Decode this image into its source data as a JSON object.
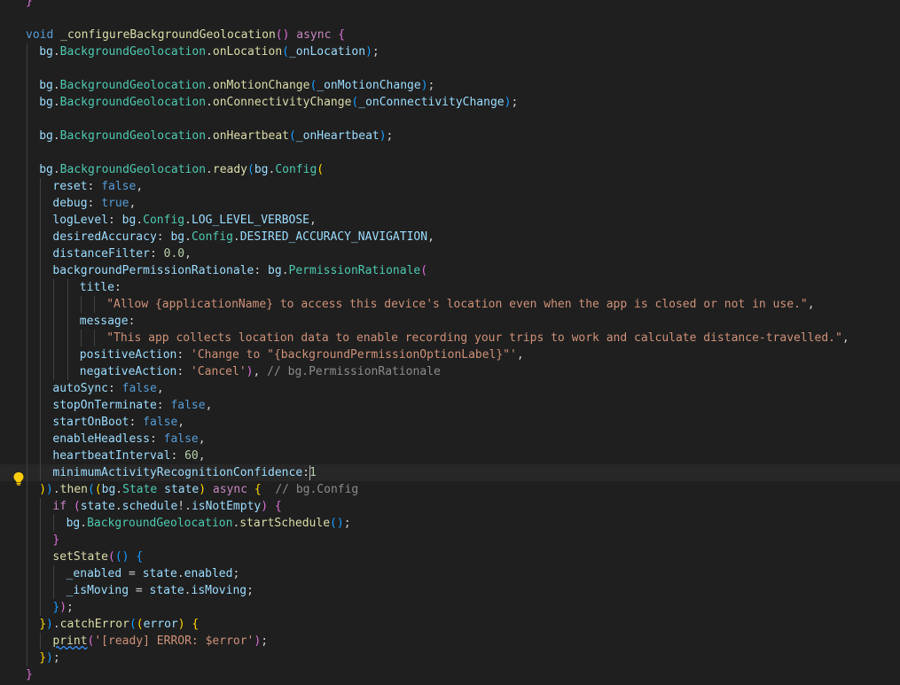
{
  "editor": {
    "lines": [
      {
        "i": 0,
        "t": [
          [
            "}",
            "br2"
          ]
        ]
      },
      {
        "i": 0,
        "t": []
      },
      {
        "i": 0,
        "t": [
          [
            "void",
            "bool"
          ],
          [
            " ",
            "plain"
          ],
          [
            "_configureBackgroundGeolocation",
            "fn"
          ],
          [
            "()",
            "br2"
          ],
          [
            " ",
            "plain"
          ],
          [
            "async",
            "kw"
          ],
          [
            " ",
            "plain"
          ],
          [
            "{",
            "br2"
          ]
        ]
      },
      {
        "i": 1,
        "t": [
          [
            "bg",
            "var"
          ],
          [
            ".",
            "plain"
          ],
          [
            "BackgroundGeolocation",
            "type"
          ],
          [
            ".",
            "plain"
          ],
          [
            "onLocation",
            "fn"
          ],
          [
            "(",
            "br3"
          ],
          [
            "_onLocation",
            "var"
          ],
          [
            ")",
            "br3"
          ],
          [
            ";",
            "plain"
          ]
        ]
      },
      {
        "i": 1,
        "t": []
      },
      {
        "i": 1,
        "t": [
          [
            "bg",
            "var"
          ],
          [
            ".",
            "plain"
          ],
          [
            "BackgroundGeolocation",
            "type"
          ],
          [
            ".",
            "plain"
          ],
          [
            "onMotionChange",
            "fn"
          ],
          [
            "(",
            "br3"
          ],
          [
            "_onMotionChange",
            "var"
          ],
          [
            ")",
            "br3"
          ],
          [
            ";",
            "plain"
          ]
        ]
      },
      {
        "i": 1,
        "t": [
          [
            "bg",
            "var"
          ],
          [
            ".",
            "plain"
          ],
          [
            "BackgroundGeolocation",
            "type"
          ],
          [
            ".",
            "plain"
          ],
          [
            "onConnectivityChange",
            "fn"
          ],
          [
            "(",
            "br3"
          ],
          [
            "_onConnectivityChange",
            "var"
          ],
          [
            ")",
            "br3"
          ],
          [
            ";",
            "plain"
          ]
        ]
      },
      {
        "i": 1,
        "t": []
      },
      {
        "i": 1,
        "t": [
          [
            "bg",
            "var"
          ],
          [
            ".",
            "plain"
          ],
          [
            "BackgroundGeolocation",
            "type"
          ],
          [
            ".",
            "plain"
          ],
          [
            "onHeartbeat",
            "fn"
          ],
          [
            "(",
            "br3"
          ],
          [
            "_onHeartbeat",
            "var"
          ],
          [
            ")",
            "br3"
          ],
          [
            ";",
            "plain"
          ]
        ]
      },
      {
        "i": 1,
        "t": []
      },
      {
        "i": 1,
        "t": [
          [
            "bg",
            "var"
          ],
          [
            ".",
            "plain"
          ],
          [
            "BackgroundGeolocation",
            "type"
          ],
          [
            ".",
            "plain"
          ],
          [
            "ready",
            "fn"
          ],
          [
            "(",
            "br3"
          ],
          [
            "bg",
            "var"
          ],
          [
            ".",
            "plain"
          ],
          [
            "Config",
            "type"
          ],
          [
            "(",
            "br1"
          ]
        ]
      },
      {
        "i": 2,
        "t": [
          [
            "reset",
            "var"
          ],
          [
            ": ",
            "plain"
          ],
          [
            "false",
            "bool"
          ],
          [
            ",",
            "plain"
          ]
        ]
      },
      {
        "i": 2,
        "t": [
          [
            "debug",
            "var"
          ],
          [
            ": ",
            "plain"
          ],
          [
            "true",
            "bool"
          ],
          [
            ",",
            "plain"
          ]
        ]
      },
      {
        "i": 2,
        "t": [
          [
            "logLevel",
            "var"
          ],
          [
            ": ",
            "plain"
          ],
          [
            "bg",
            "var"
          ],
          [
            ".",
            "plain"
          ],
          [
            "Config",
            "type"
          ],
          [
            ".",
            "plain"
          ],
          [
            "LOG_LEVEL_VERBOSE",
            "var"
          ],
          [
            ",",
            "plain"
          ]
        ]
      },
      {
        "i": 2,
        "t": [
          [
            "desiredAccuracy",
            "var"
          ],
          [
            ": ",
            "plain"
          ],
          [
            "bg",
            "var"
          ],
          [
            ".",
            "plain"
          ],
          [
            "Config",
            "type"
          ],
          [
            ".",
            "plain"
          ],
          [
            "DESIRED_ACCURACY_NAVIGATION",
            "var"
          ],
          [
            ",",
            "plain"
          ]
        ]
      },
      {
        "i": 2,
        "t": [
          [
            "distanceFilter",
            "var"
          ],
          [
            ": ",
            "plain"
          ],
          [
            "0.0",
            "num"
          ],
          [
            ",",
            "plain"
          ]
        ]
      },
      {
        "i": 2,
        "t": [
          [
            "backgroundPermissionRationale",
            "var"
          ],
          [
            ": ",
            "plain"
          ],
          [
            "bg",
            "var"
          ],
          [
            ".",
            "plain"
          ],
          [
            "PermissionRationale",
            "type"
          ],
          [
            "(",
            "br2"
          ]
        ]
      },
      {
        "i": 4,
        "t": [
          [
            "title",
            "var"
          ],
          [
            ":",
            "plain"
          ]
        ]
      },
      {
        "i": 6,
        "t": [
          [
            "\"Allow {applicationName} to access this device's location even when the app is closed or not in use.\"",
            "str"
          ],
          [
            ",",
            "plain"
          ]
        ]
      },
      {
        "i": 4,
        "t": [
          [
            "message",
            "var"
          ],
          [
            ":",
            "plain"
          ]
        ]
      },
      {
        "i": 6,
        "t": [
          [
            "\"This app collects location data to enable recording your trips to work and calculate distance-travelled.\"",
            "str"
          ],
          [
            ",",
            "plain"
          ]
        ]
      },
      {
        "i": 4,
        "t": [
          [
            "positiveAction",
            "var"
          ],
          [
            ": ",
            "plain"
          ],
          [
            "'Change to \"{backgroundPermissionOptionLabel}\"'",
            "str"
          ],
          [
            ",",
            "plain"
          ]
        ]
      },
      {
        "i": 4,
        "t": [
          [
            "negativeAction",
            "var"
          ],
          [
            ": ",
            "plain"
          ],
          [
            "'Cancel'",
            "str"
          ],
          [
            ")",
            "br2"
          ],
          [
            ", ",
            "plain"
          ],
          [
            "// bg.PermissionRationale",
            "hint"
          ]
        ]
      },
      {
        "i": 2,
        "t": [
          [
            "autoSync",
            "var"
          ],
          [
            ": ",
            "plain"
          ],
          [
            "false",
            "bool"
          ],
          [
            ",",
            "plain"
          ]
        ]
      },
      {
        "i": 2,
        "t": [
          [
            "stopOnTerminate",
            "var"
          ],
          [
            ": ",
            "plain"
          ],
          [
            "false",
            "bool"
          ],
          [
            ",",
            "plain"
          ]
        ]
      },
      {
        "i": 2,
        "t": [
          [
            "startOnBoot",
            "var"
          ],
          [
            ": ",
            "plain"
          ],
          [
            "false",
            "bool"
          ],
          [
            ",",
            "plain"
          ]
        ]
      },
      {
        "i": 2,
        "t": [
          [
            "enableHeadless",
            "var"
          ],
          [
            ": ",
            "plain"
          ],
          [
            "false",
            "bool"
          ],
          [
            ",",
            "plain"
          ]
        ]
      },
      {
        "i": 2,
        "t": [
          [
            "heartbeatInterval",
            "var"
          ],
          [
            ": ",
            "plain"
          ],
          [
            "60",
            "num"
          ],
          [
            ",",
            "plain"
          ]
        ]
      },
      {
        "i": 2,
        "t": [
          [
            "minimumActivityRecognitionConfidence",
            "var"
          ],
          [
            ":",
            "plain"
          ],
          [
            "1",
            "num"
          ]
        ],
        "cursor": true,
        "bulb": true
      },
      {
        "i": 1,
        "t": [
          [
            ")",
            "br1"
          ],
          [
            ")",
            "br3"
          ],
          [
            ".",
            "plain"
          ],
          [
            "then",
            "fn"
          ],
          [
            "(",
            "br3"
          ],
          [
            "(",
            "br1"
          ],
          [
            "bg",
            "var"
          ],
          [
            ".",
            "plain"
          ],
          [
            "State",
            "type"
          ],
          [
            " state",
            "var"
          ],
          [
            ")",
            "br1"
          ],
          [
            " ",
            "plain"
          ],
          [
            "async",
            "kw"
          ],
          [
            " ",
            "plain"
          ],
          [
            "{",
            "br1"
          ],
          [
            "  ",
            "plain"
          ],
          [
            "// bg.Config",
            "hint"
          ]
        ]
      },
      {
        "i": 2,
        "t": [
          [
            "if",
            "kw"
          ],
          [
            " ",
            "plain"
          ],
          [
            "(",
            "br2"
          ],
          [
            "state",
            "var"
          ],
          [
            ".",
            "plain"
          ],
          [
            "schedule",
            "var"
          ],
          [
            "!",
            "plain"
          ],
          [
            ".",
            "plain"
          ],
          [
            "isNotEmpty",
            "var"
          ],
          [
            ")",
            "br2"
          ],
          [
            " ",
            "plain"
          ],
          [
            "{",
            "br2"
          ]
        ]
      },
      {
        "i": 3,
        "t": [
          [
            "bg",
            "var"
          ],
          [
            ".",
            "plain"
          ],
          [
            "BackgroundGeolocation",
            "type"
          ],
          [
            ".",
            "plain"
          ],
          [
            "startSchedule",
            "fn"
          ],
          [
            "()",
            "br3"
          ],
          [
            ";",
            "plain"
          ]
        ]
      },
      {
        "i": 2,
        "t": [
          [
            "}",
            "br2"
          ]
        ]
      },
      {
        "i": 2,
        "t": [
          [
            "setState",
            "fn"
          ],
          [
            "(",
            "br2"
          ],
          [
            "()",
            "br3"
          ],
          [
            " ",
            "plain"
          ],
          [
            "{",
            "br3"
          ]
        ]
      },
      {
        "i": 3,
        "t": [
          [
            "_enabled",
            "var"
          ],
          [
            " = ",
            "plain"
          ],
          [
            "state",
            "var"
          ],
          [
            ".",
            "plain"
          ],
          [
            "enabled",
            "var"
          ],
          [
            ";",
            "plain"
          ]
        ]
      },
      {
        "i": 3,
        "t": [
          [
            "_isMoving",
            "var"
          ],
          [
            " = ",
            "plain"
          ],
          [
            "state",
            "var"
          ],
          [
            ".",
            "plain"
          ],
          [
            "isMoving",
            "var"
          ],
          [
            ";",
            "plain"
          ]
        ]
      },
      {
        "i": 2,
        "t": [
          [
            "}",
            "br3"
          ],
          [
            ")",
            "br2"
          ],
          [
            ";",
            "plain"
          ]
        ]
      },
      {
        "i": 1,
        "t": [
          [
            "}",
            "br1"
          ],
          [
            ")",
            "br3"
          ],
          [
            ".",
            "plain"
          ],
          [
            "catchError",
            "fn"
          ],
          [
            "(",
            "br3"
          ],
          [
            "(",
            "br1"
          ],
          [
            "error",
            "var"
          ],
          [
            ")",
            "br1"
          ],
          [
            " ",
            "plain"
          ],
          [
            "{",
            "br1"
          ]
        ]
      },
      {
        "i": 2,
        "t": [
          [
            "print",
            "fn",
            "squig"
          ],
          [
            "(",
            "br2"
          ],
          [
            "'[ready] ERROR: $error'",
            "str"
          ],
          [
            ")",
            "br2"
          ],
          [
            ";",
            "plain"
          ]
        ]
      },
      {
        "i": 1,
        "t": [
          [
            "}",
            "br1"
          ],
          [
            ")",
            "br3"
          ],
          [
            ";",
            "plain"
          ]
        ]
      },
      {
        "i": 0,
        "t": [
          [
            "}",
            "br2"
          ]
        ]
      }
    ]
  },
  "colors": {
    "background": "#1f1f1f",
    "keyword": "#c586c0",
    "type": "#4ec9b0",
    "function": "#dcdcaa",
    "variable": "#9cdcfe",
    "string": "#ce9178",
    "boolean": "#569cd6",
    "number": "#b5cea8",
    "hint": "#8b8b8b"
  },
  "icons": {
    "gutter": "lightbulb-icon"
  }
}
